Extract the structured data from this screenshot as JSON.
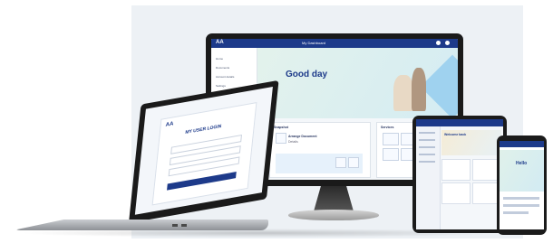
{
  "monitor": {
    "logo": "AA",
    "top_title": "My Dashboard",
    "greeting": "Good day",
    "nav": [
      "Home",
      "Documents",
      "Account details",
      "Settings"
    ],
    "card1_title": "Snapshot",
    "card1_item": "Arrange Document",
    "card1_sub": "Details",
    "card2_title": "Services"
  },
  "laptop": {
    "logo": "AA",
    "heading": "MY USER LOGIN"
  },
  "tablet": {
    "welcome": "Welcome back"
  },
  "phone": {
    "greeting": "Hello"
  },
  "colors": {
    "brand": "#1d3a8a",
    "hero_teal": "#d4ecf3",
    "accent_blue": "#9fd2ef"
  }
}
